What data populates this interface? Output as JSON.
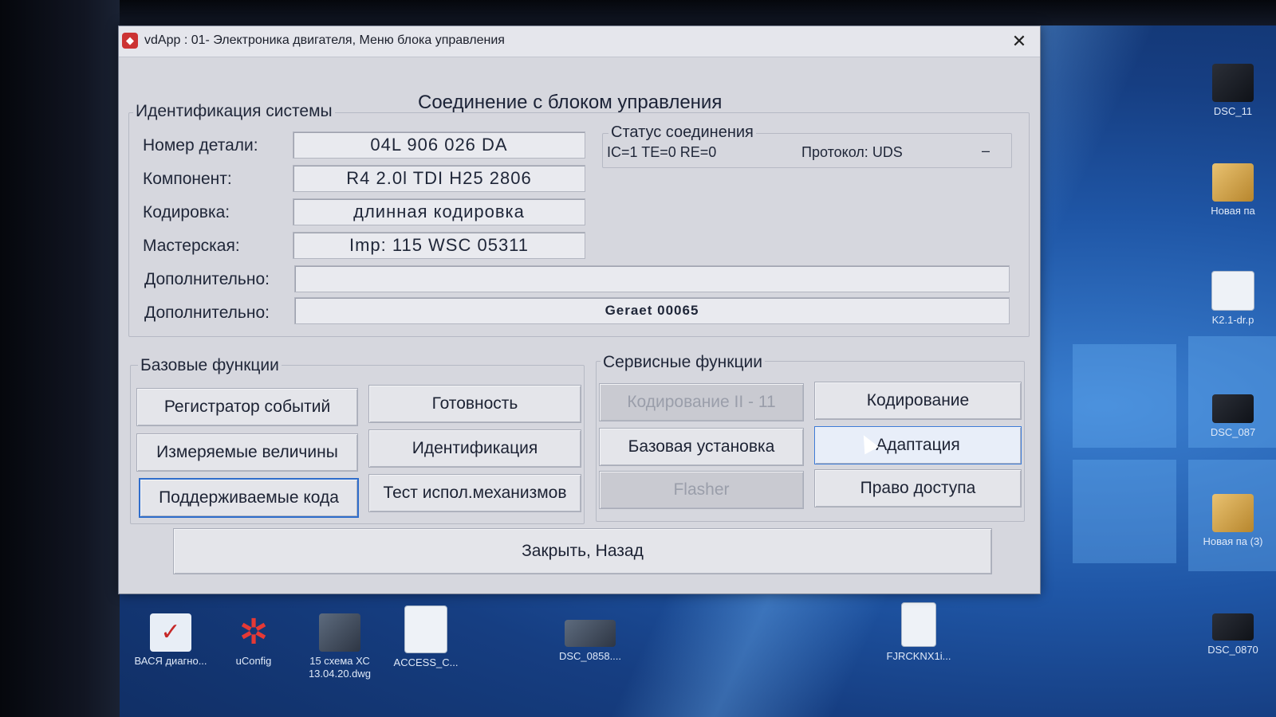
{
  "window": {
    "title": "vdApp : 01- Электроника двигателя,  Меню блока управления",
    "close_symbol": "✕",
    "heading": "Соединение с блоком управления"
  },
  "identification": {
    "title": "Идентификация системы",
    "fields": [
      {
        "label": "Номер детали:",
        "value": "04L 906 026 DA"
      },
      {
        "label": "Компонент:",
        "value": "R4 2.0l TDI    H25 2806"
      },
      {
        "label": "Кодировка:",
        "value": "длинная кодировка"
      },
      {
        "label": "Мастерская:",
        "value": "Imp: 115      WSC 05311"
      },
      {
        "label": "Дополнительно:",
        "value": ""
      },
      {
        "label": "Дополнительно:",
        "value": "Geraet 00065"
      }
    ]
  },
  "connection_status": {
    "title": "Статус соединения",
    "counters": "IC=1  TE=0   RE=0",
    "protocol": "Протокол: UDS",
    "indicator": "–"
  },
  "basic_functions": {
    "title": "Базовые функции",
    "buttons": [
      {
        "label": "Регистратор событий",
        "state": "normal"
      },
      {
        "label": "Готовность",
        "state": "normal"
      },
      {
        "label": "Измеряемые величины",
        "state": "normal"
      },
      {
        "label": "Идентификация",
        "state": "normal"
      },
      {
        "label": "Поддерживаемые кода",
        "state": "focused"
      },
      {
        "label": "Тест испол.механизмов",
        "state": "normal"
      }
    ]
  },
  "service_functions": {
    "title": "Сервисные функции",
    "buttons": [
      {
        "label": "Кодирование II - 11",
        "state": "disabled"
      },
      {
        "label": "Кодирование",
        "state": "normal"
      },
      {
        "label": "Базовая установка",
        "state": "normal"
      },
      {
        "label": "Адаптация",
        "state": "hovered"
      },
      {
        "label": "Flasher",
        "state": "disabled"
      },
      {
        "label": "Право доступа",
        "state": "normal"
      }
    ]
  },
  "close_button": {
    "label": "Закрыть, Назад"
  },
  "desktop_icons": [
    {
      "label": "ВАСЯ диагно...",
      "icon": "diagnostic-app-icon"
    },
    {
      "label": "uConfig",
      "icon": "uconfig-icon"
    },
    {
      "label": "15 схема ХС 13.04.20.dwg",
      "icon": "dwg-file-icon"
    },
    {
      "label": "ACCESS_C...",
      "icon": "access-file-icon"
    },
    {
      "label": "DSC_0858....",
      "icon": "image-file-icon"
    },
    {
      "label": "FJRCKNX1i...",
      "icon": "blank-file-icon"
    },
    {
      "label": "DSC_11",
      "icon": "image-file-icon"
    },
    {
      "label": "Новая па",
      "icon": "folder-icon"
    },
    {
      "label": "K2.1-dr.p",
      "icon": "document-icon"
    },
    {
      "label": "DSC_087",
      "icon": "image-file-icon"
    },
    {
      "label": "Новая па (3)",
      "icon": "folder-icon"
    },
    {
      "label": "DSC_0870",
      "icon": "image-file-icon"
    }
  ]
}
